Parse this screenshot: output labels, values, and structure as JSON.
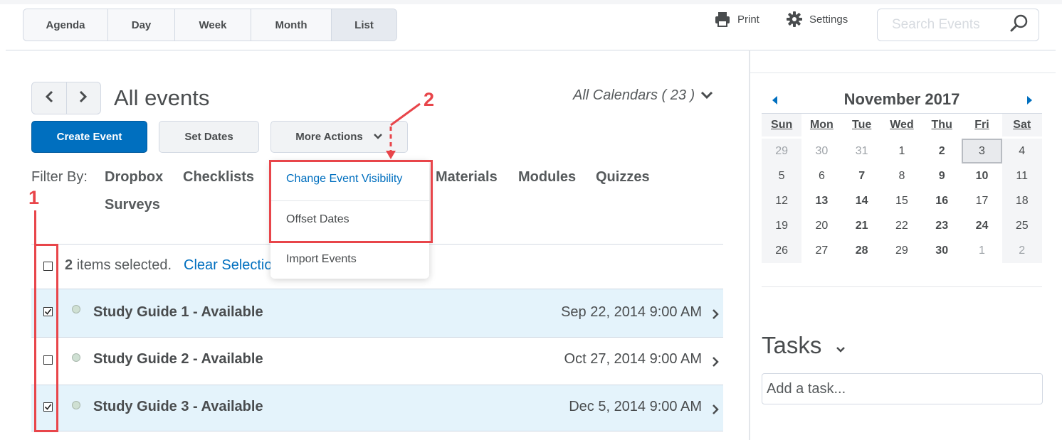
{
  "view_tabs": [
    "Agenda",
    "Day",
    "Week",
    "Month",
    "List"
  ],
  "active_view": "List",
  "header": {
    "print_label": "Print",
    "settings_label": "Settings",
    "search_placeholder": "Search Events"
  },
  "main": {
    "heading": "All events",
    "calendar_selector": "All Calendars ( 23 )",
    "create_event_label": "Create Event",
    "set_dates_label": "Set Dates",
    "more_actions_label": "More Actions",
    "filter_label": "Filter By:",
    "filters": [
      "Dropbox",
      "Checklists",
      "Materials",
      "Modules",
      "Quizzes",
      "Surveys"
    ]
  },
  "dropdown": {
    "items": [
      "Change Event Visibility",
      "Offset Dates",
      "Import Events"
    ]
  },
  "selection": {
    "count": "2",
    "text": "items selected.",
    "clear_label": "Clear Selection"
  },
  "events": [
    {
      "title": "Study Guide 1 - Available",
      "date": "Sep 22, 2014 9:00 AM",
      "checked": true
    },
    {
      "title": "Study Guide 2 - Available",
      "date": "Oct 27, 2014 9:00 AM",
      "checked": false
    },
    {
      "title": "Study Guide 3 - Available",
      "date": "Dec 5, 2014 9:00 AM",
      "checked": true
    }
  ],
  "annotations": {
    "one": "1",
    "two": "2"
  },
  "calendar": {
    "title": "November 2017",
    "weekdays": [
      "Sun",
      "Mon",
      "Tue",
      "Wed",
      "Thu",
      "Fri",
      "Sat"
    ],
    "weeks": [
      [
        "29",
        "30",
        "31",
        "1",
        "2",
        "3",
        "4"
      ],
      [
        "5",
        "6",
        "7",
        "8",
        "9",
        "10",
        "11"
      ],
      [
        "12",
        "13",
        "14",
        "15",
        "16",
        "17",
        "18"
      ],
      [
        "19",
        "20",
        "21",
        "22",
        "23",
        "24",
        "25"
      ],
      [
        "26",
        "27",
        "28",
        "29",
        "30",
        "1",
        "2"
      ]
    ],
    "today": "3",
    "days_with_events": [
      "2",
      "7",
      "9",
      "10",
      "13",
      "14",
      "16",
      "21",
      "23",
      "24",
      "28",
      "30"
    ]
  },
  "tasks": {
    "title": "Tasks",
    "placeholder": "Add a task..."
  },
  "colors": {
    "accent": "#006fbf",
    "annotation": "#e8454a",
    "selected_row": "#e4f3fb"
  }
}
